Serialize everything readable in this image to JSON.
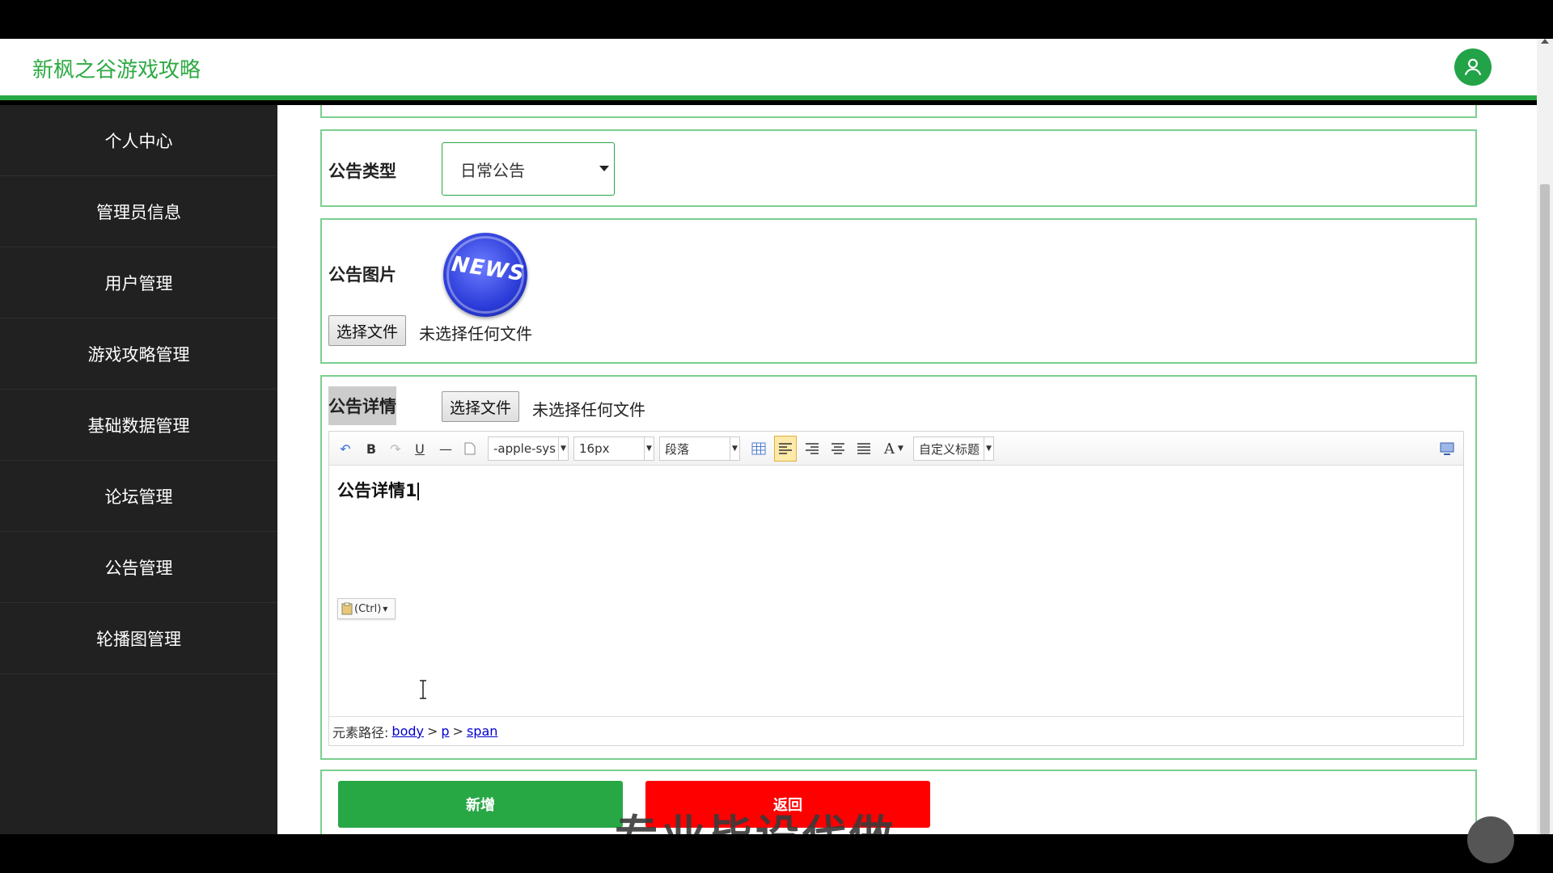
{
  "header": {
    "title": "新枫之谷游戏攻略"
  },
  "sidebar": {
    "items": [
      {
        "label": "个人中心"
      },
      {
        "label": "管理员信息"
      },
      {
        "label": "用户管理"
      },
      {
        "label": "游戏攻略管理"
      },
      {
        "label": "基础数据管理"
      },
      {
        "label": "论坛管理"
      },
      {
        "label": "公告管理"
      },
      {
        "label": "轮播图管理"
      }
    ]
  },
  "form": {
    "type": {
      "label": "公告类型",
      "value": "日常公告"
    },
    "image": {
      "label": "公告图片",
      "news_text": "NEWS",
      "file_button": "选择文件",
      "file_status": "未选择任何文件"
    },
    "detail": {
      "label": "公告详情",
      "file_button": "选择文件",
      "file_status": "未选择任何文件",
      "toolbar": {
        "font_family": "-apple-sys",
        "font_size": "16px",
        "paragraph": "段落",
        "font_color_label": "A",
        "custom_heading": "自定义标题"
      },
      "content": "公告详情1",
      "paste_hint": "(Ctrl)",
      "path_label": "元素路径:",
      "path": [
        "body",
        "p",
        "span"
      ]
    },
    "buttons": {
      "add": "新增",
      "back": "返回"
    }
  },
  "overlay": {
    "watermark": "专业毕设代做"
  },
  "colors": {
    "brand_green": "#28a745",
    "danger_red": "#ff0000",
    "sidebar_bg": "#212121"
  }
}
